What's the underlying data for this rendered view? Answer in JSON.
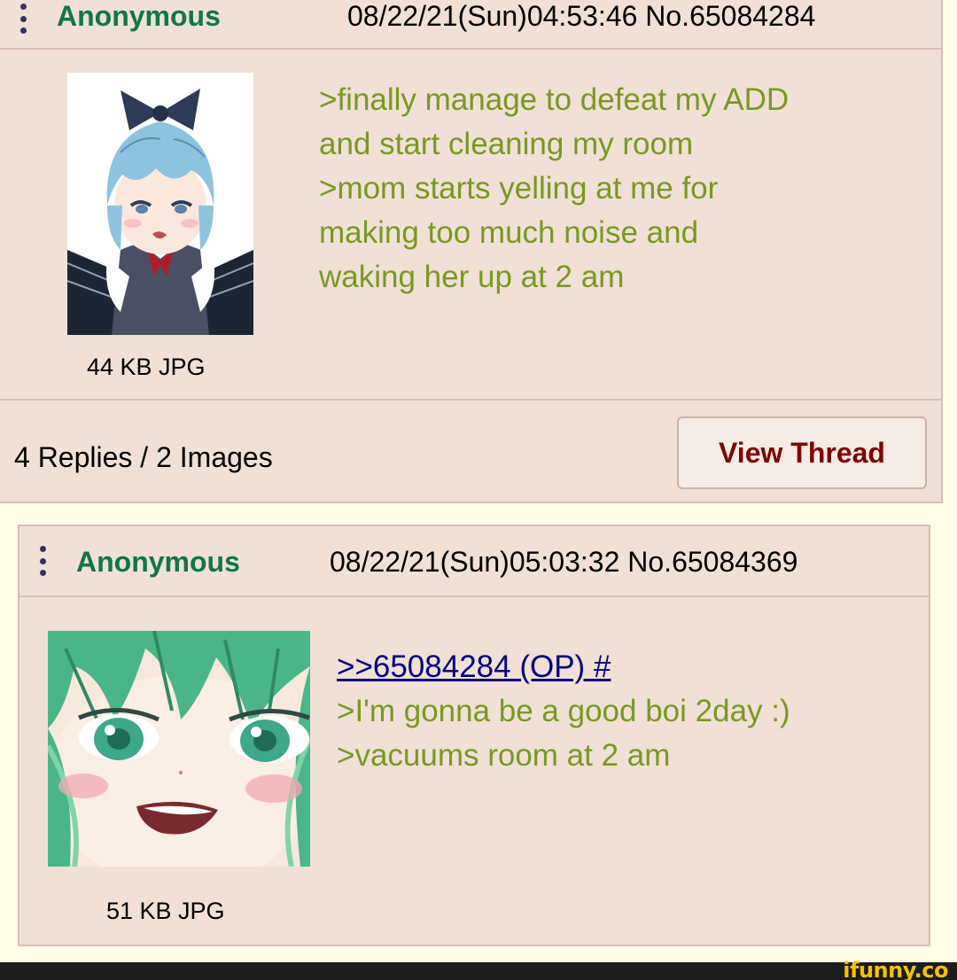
{
  "op": {
    "name": "Anonymous",
    "datetime": "08/22/21(Sun)04:53:46",
    "post_number": "No.65084284",
    "file_info": "44 KB JPG",
    "lines": [
      ">finally manage to defeat my ADD",
      "and start cleaning my room",
      ">mom starts yelling at me for",
      "making too much noise and",
      "waking her up at 2 am"
    ],
    "summary": "4 Replies / 2 Images",
    "view_thread_label": "View Thread"
  },
  "reply": {
    "name": "Anonymous",
    "datetime": "08/22/21(Sun)05:03:32",
    "post_number": "No.65084369",
    "file_info": "51 KB JPG",
    "quote_link": ">>65084284 (OP) #",
    "lines": [
      ">I'm gonna be a good boi 2day :)",
      ">vacuums room at 2 am"
    ]
  },
  "watermark": "ifunny.co",
  "colors": {
    "post_background": "#f0e0d6",
    "page_background": "#fdfce8",
    "name": "#117743",
    "greentext": "#789922",
    "quote_link": "#000080",
    "view_thread_text": "#800000"
  },
  "icons": {
    "post_menu": "vertical-dots-icon"
  }
}
